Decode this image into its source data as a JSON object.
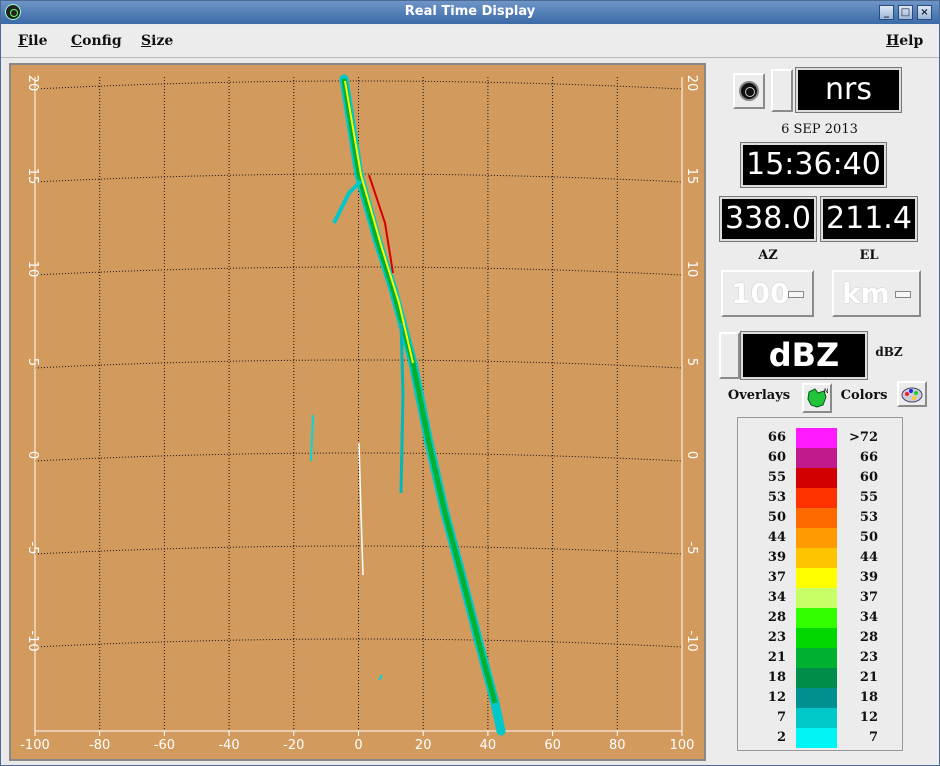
{
  "window": {
    "title": "Real Time Display"
  },
  "menubar": {
    "items": [
      {
        "first": "F",
        "rest": "ile"
      },
      {
        "first": "C",
        "rest": "onfig"
      },
      {
        "first": "S",
        "rest": "ize"
      }
    ],
    "help": {
      "first": "H",
      "rest": "elp"
    }
  },
  "plot": {
    "x_ticks": [
      "-100",
      "-80",
      "-60",
      "-40",
      "-20",
      "0",
      "20",
      "40",
      "60",
      "80",
      "100"
    ],
    "y_ticks": [
      "20",
      "15",
      "10",
      "5",
      "0",
      "-5",
      "-10"
    ],
    "colors": {
      "background": "#d39a5e",
      "grid": "#111111",
      "axis": "#ffffff"
    }
  },
  "panel": {
    "radar": "nrs",
    "date": "6 SEP 2013",
    "time": "15:36:40",
    "az": "338.0",
    "el": "211.4",
    "az_label": "AZ",
    "el_label": "EL",
    "range": "100",
    "unit": "km",
    "field": "dBZ",
    "field_units": "dBZ",
    "overlays_label": "Overlays",
    "colors_label": "Colors"
  },
  "legend": [
    {
      "lo": "66",
      "hi": ">72",
      "color": "#ff1aff"
    },
    {
      "lo": "60",
      "hi": "66",
      "color": "#c01a8c"
    },
    {
      "lo": "55",
      "hi": "60",
      "color": "#d30000"
    },
    {
      "lo": "53",
      "hi": "55",
      "color": "#ff3300"
    },
    {
      "lo": "50",
      "hi": "53",
      "color": "#ff6a00"
    },
    {
      "lo": "44",
      "hi": "50",
      "color": "#ff9a00"
    },
    {
      "lo": "39",
      "hi": "44",
      "color": "#ffc400"
    },
    {
      "lo": "37",
      "hi": "39",
      "color": "#ffff00"
    },
    {
      "lo": "34",
      "hi": "37",
      "color": "#c8ff66"
    },
    {
      "lo": "28",
      "hi": "34",
      "color": "#33ff00"
    },
    {
      "lo": "23",
      "hi": "28",
      "color": "#00d800"
    },
    {
      "lo": "21",
      "hi": "23",
      "color": "#00b030"
    },
    {
      "lo": "18",
      "hi": "21",
      "color": "#008c4a"
    },
    {
      "lo": "12",
      "hi": "18",
      "color": "#009090"
    },
    {
      "lo": "7",
      "hi": "12",
      "color": "#00c8c8"
    },
    {
      "lo": "2",
      "hi": "7",
      "color": "#00f5f5"
    }
  ]
}
